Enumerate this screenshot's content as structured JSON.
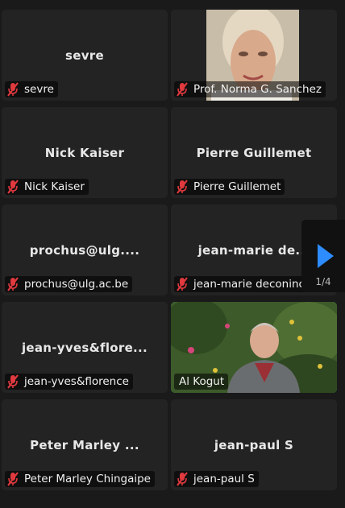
{
  "participants": [
    {
      "display_name": "sevre",
      "label": "sevre"
    },
    {
      "display_name": "",
      "label": "Prof. Norma G. Sanchez"
    },
    {
      "display_name": "Nick Kaiser",
      "label": "Nick Kaiser"
    },
    {
      "display_name": "Pierre Guillemet",
      "label": "Pierre Guillemet"
    },
    {
      "display_name": "prochus@ulg....",
      "label": "prochus@ulg.ac.be"
    },
    {
      "display_name": "jean-marie de...",
      "label": "jean-marie deconinck"
    },
    {
      "display_name": "jean-yves&flore...",
      "label": "jean-yves&florence"
    },
    {
      "display_name": "",
      "label": "Al Kogut"
    },
    {
      "display_name": "Peter Marley ...",
      "label": "Peter Marley Chingaipe"
    },
    {
      "display_name": "jean-paul S",
      "label": "jean-paul S"
    }
  ],
  "pagination": {
    "current": "1/4"
  },
  "colors": {
    "active_speaker": "#22c55e",
    "mute_icon": "#e0393e",
    "next_arrow": "#2d8cff"
  },
  "icons": {
    "mute": "muted-mic-icon",
    "next": "next-page-icon"
  }
}
